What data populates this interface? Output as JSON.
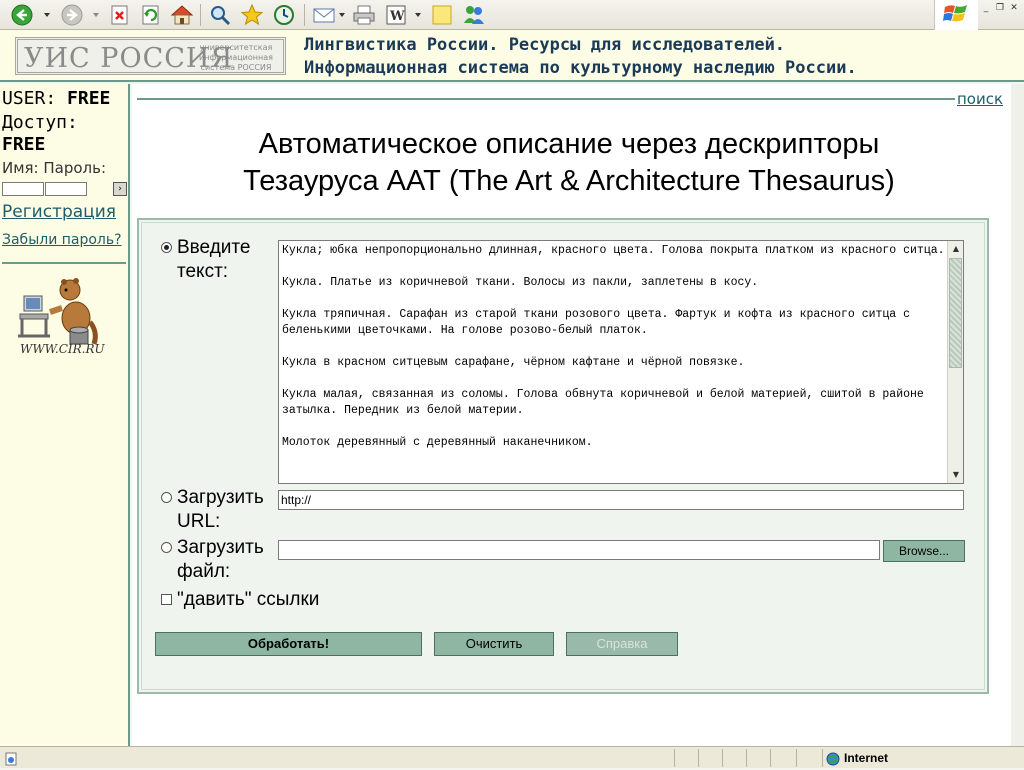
{
  "toolbar": {
    "icons": [
      "back-icon",
      "forward-icon",
      "stop-icon",
      "refresh-icon",
      "home-icon",
      "search-icon",
      "favorites-icon",
      "history-icon",
      "mail-icon",
      "print-icon",
      "word-icon",
      "notes-icon",
      "messenger-icon"
    ]
  },
  "header": {
    "logo_text": "УИС РОССИЯ",
    "logo_sub": [
      "университетская",
      "информационная",
      "система РОССИЯ"
    ],
    "title_line1": "Лингвистика России. Ресурсы для исследователей.",
    "title_line2": "Информационная система по культурному наследию России."
  },
  "sidebar": {
    "user_label": "USER:",
    "user_value": "FREE",
    "access_label": "Доступ:",
    "access_value": "FREE",
    "login_label": "Имя: Пароль:",
    "go_symbol": "›",
    "register_link": "Регистрация",
    "forgot_link": "Забыли пароль?",
    "cir_caption": "WWW.CIR.RU"
  },
  "main": {
    "search_link": "поиск",
    "heading_line1": "Автоматическое описание через дескрипторы",
    "heading_line2": "Тезауруса ААТ (The Art & Architecture Thesaurus)",
    "option_text_line1": "Введите",
    "option_text_line2": "текст:",
    "option_url_line1": "Загрузить",
    "option_url_line2": "URL:",
    "option_file_line1": "Загрузить",
    "option_file_line2": "файл:",
    "checkbox_label": "\"давить\" ссылки",
    "textarea_value": "Кукла; юбка непропорционально длинная, красного цвета. Голова покрыта платком из красного ситца.\n\nКукла. Платье из коричневой ткани. Волосы из пакли, заплетены в косу.\n\nКукла тряпичная. Сарафан из старой ткани розового цвета. Фартук и кофта из красного ситца с беленькими цветочками. На голове розово-белый платок.\n\nКукла в красном ситцевым сарафане, чёрном кафтане и чёрной повязке.\n\nКукла малая, связанная из соломы. Голова обвнута коричневой и белой материей, сшитой в районе затылка. Передник из белой материи.\n\nМолоток деревянный с деревянный наканечником.",
    "url_value": "http://",
    "file_value": "",
    "browse_label": "Browse...",
    "submit_label": "Обработать!",
    "clear_label": "Очистить",
    "help_label": "Справка"
  },
  "statusbar": {
    "zone": "Internet"
  },
  "colors": {
    "accent": "#6a9a8a",
    "button": "#8fb5a3",
    "link": "#1f5d69",
    "sidebar_bg": "#fdfde6",
    "title_text": "#1b3a57"
  }
}
